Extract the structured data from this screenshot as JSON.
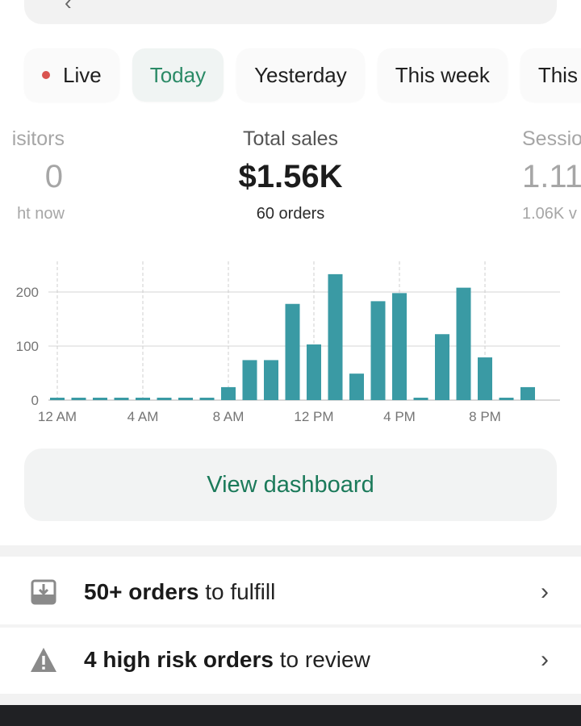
{
  "search": {
    "back_icon": "chevron-left-icon",
    "text": ""
  },
  "tabs": [
    {
      "label": "Live",
      "indicator": "live-dot",
      "active": false
    },
    {
      "label": "Today",
      "active": true
    },
    {
      "label": "Yesterday",
      "active": false
    },
    {
      "label": "This week",
      "active": false
    },
    {
      "label": "This",
      "active": false
    }
  ],
  "metrics": {
    "visitors": {
      "label": "isitors",
      "value": "0",
      "sub": "ht now"
    },
    "total_sales": {
      "label": "Total sales",
      "value": "$1.56K",
      "sub": "60 orders"
    },
    "sessions": {
      "label": "Sessio",
      "value": "1.11",
      "sub": "1.06K v"
    }
  },
  "colors": {
    "accent": "#2a8a66",
    "bar": "#3a9aa4",
    "live": "#d9534f"
  },
  "chart_data": {
    "type": "bar",
    "title": "",
    "xlabel": "",
    "ylabel": "",
    "x": [
      "12 AM",
      "1 AM",
      "2 AM",
      "3 AM",
      "4 AM",
      "5 AM",
      "6 AM",
      "7 AM",
      "8 AM",
      "9 AM",
      "10 AM",
      "11 AM",
      "12 PM",
      "1 PM",
      "2 PM",
      "3 PM",
      "4 PM",
      "5 PM",
      "6 PM",
      "7 PM",
      "8 PM",
      "9 PM",
      "10 PM",
      "11 PM"
    ],
    "values": [
      3,
      3,
      3,
      3,
      3,
      3,
      3,
      3,
      24,
      74,
      74,
      178,
      103,
      233,
      49,
      183,
      198,
      3,
      122,
      208,
      79,
      3,
      24,
      0
    ],
    "x_tick_labels": [
      "12 AM",
      "4 AM",
      "8 AM",
      "12 PM",
      "4 PM",
      "8 PM"
    ],
    "y_ticks": [
      0,
      100,
      200
    ],
    "ylim": [
      0,
      250
    ],
    "grid": true
  },
  "dashboard_button": {
    "label": "View dashboard"
  },
  "tasks": [
    {
      "icon": "inbox-download-icon",
      "bold": "50+ orders",
      "rest": " to fulfill",
      "chevron": "›"
    },
    {
      "icon": "warning-triangle-icon",
      "bold": "4 high risk orders",
      "rest": " to review",
      "chevron": "›"
    }
  ]
}
